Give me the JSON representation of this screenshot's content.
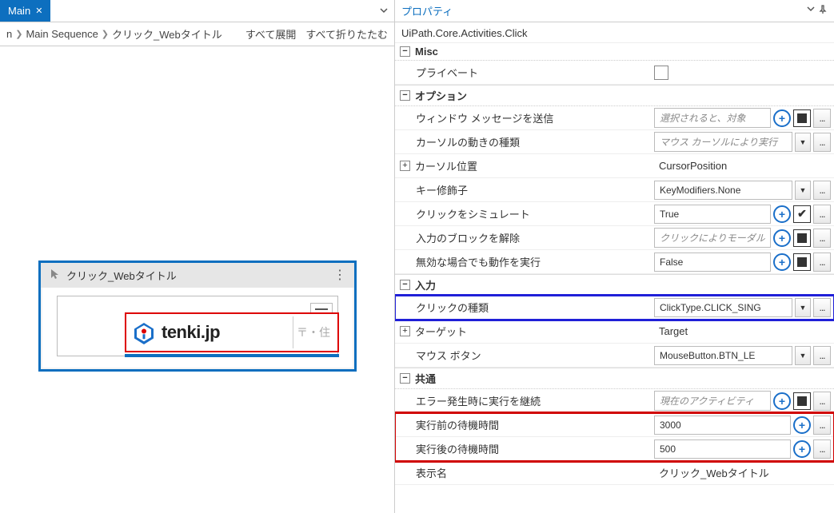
{
  "tab": {
    "name": "Main"
  },
  "breadcrumb": {
    "root": "n",
    "items": [
      "Main Sequence",
      "クリック_Webタイトル"
    ],
    "expand_all": "すべて展開",
    "collapse_all": "すべて折りたたむ"
  },
  "activity": {
    "title": "クリック_Webタイトル",
    "logo_text": "tenki.jp",
    "input_placeholder": "〒・住"
  },
  "properties": {
    "panel_title": "プロパティ",
    "type": "UiPath.Core.Activities.Click",
    "categories": {
      "misc": {
        "label": "Misc",
        "private": {
          "label": "プライベート",
          "checked": false
        }
      },
      "options": {
        "label": "オプション",
        "send_window_messages": {
          "label": "ウィンドウ メッセージを送信",
          "placeholder": "選択されると、対象"
        },
        "cursor_motion_type": {
          "label": "カーソルの動きの種類",
          "placeholder": "マウス カーソルにより実行"
        },
        "cursor_position": {
          "label": "カーソル位置",
          "value": "CursorPosition"
        },
        "key_modifiers": {
          "label": "キー修飾子",
          "value": "KeyModifiers.None"
        },
        "simulate_click": {
          "label": "クリックをシミュレート",
          "value": "True",
          "checked": true
        },
        "unblock_input": {
          "label": "入力のブロックを解除",
          "placeholder": "クリックによりモーダル"
        },
        "continue_if_invalid": {
          "label": "無効な場合でも動作を実行",
          "value": "False"
        }
      },
      "input": {
        "label": "入力",
        "click_type": {
          "label": "クリックの種類",
          "value": "ClickType.CLICK_SING"
        },
        "target": {
          "label": "ターゲット",
          "value": "Target"
        },
        "mouse_button": {
          "label": "マウス ボタン",
          "value": "MouseButton.BTN_LE"
        }
      },
      "common": {
        "label": "共通",
        "continue_on_error": {
          "label": "エラー発生時に実行を継続",
          "placeholder": "現在のアクティビティ"
        },
        "delay_before": {
          "label": "実行前の待機時間",
          "value": "3000"
        },
        "delay_after": {
          "label": "実行後の待機時間",
          "value": "500"
        },
        "display_name": {
          "label": "表示名",
          "value": "クリック_Webタイトル"
        }
      }
    }
  }
}
